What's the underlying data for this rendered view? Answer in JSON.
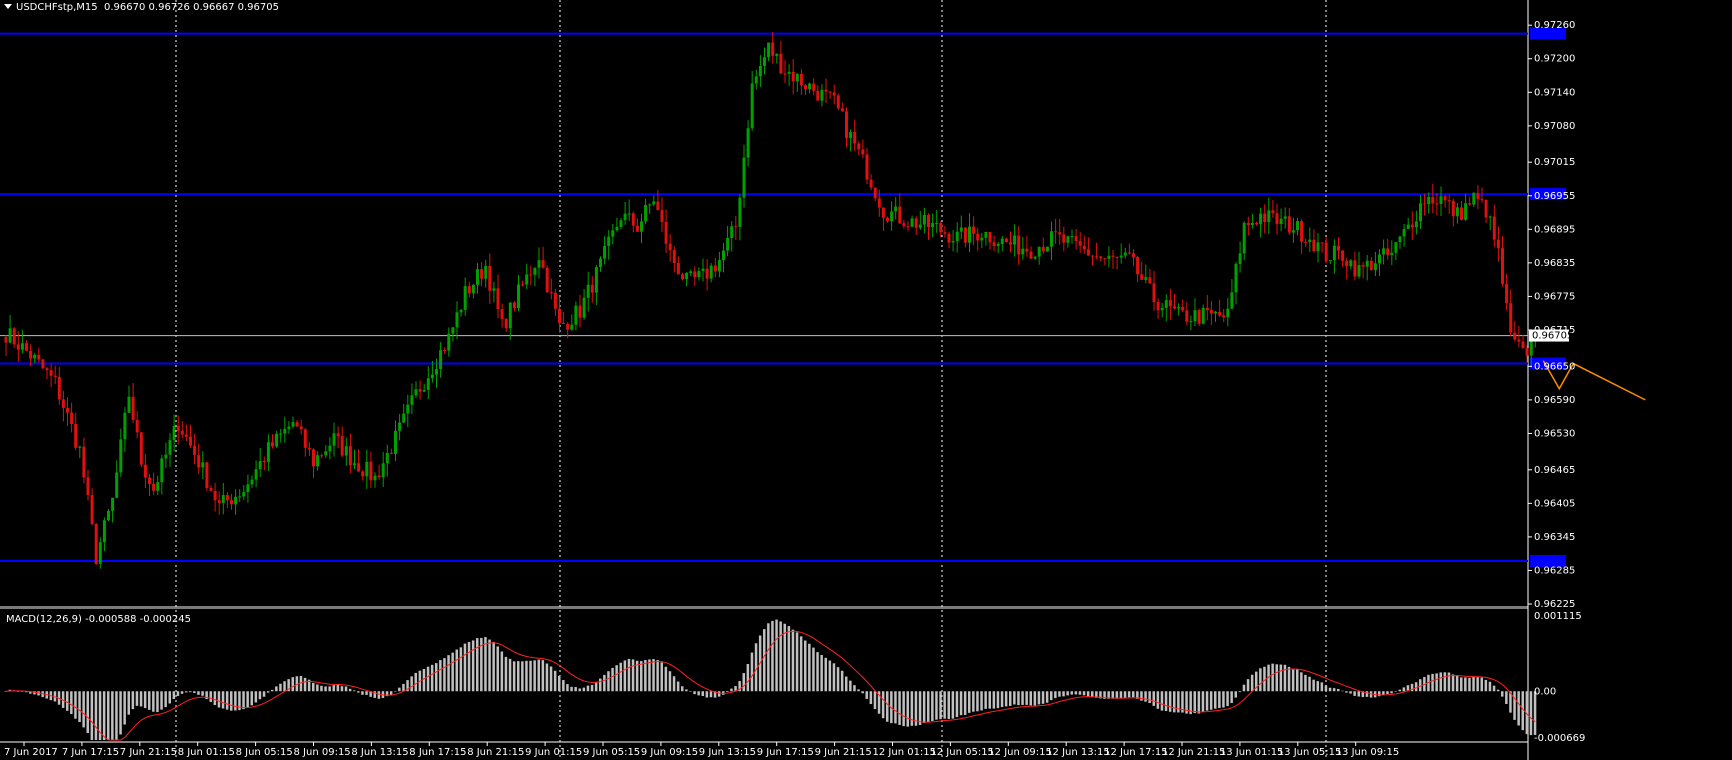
{
  "header": {
    "symbol": "USDCHFstp,M15",
    "open": "0.96670",
    "high": "0.96726",
    "low": "0.96667",
    "close": "0.96705"
  },
  "macd_header": {
    "label": "MACD(12,26,9)",
    "value1": "-0.000588",
    "value2": "-0.000245"
  },
  "colors": {
    "background": "#000000",
    "bull": "#00a000",
    "bear": "#e01010",
    "level_line": "#0000ff",
    "bid_line": "#c0c0c0",
    "forecast": "#ff8c00",
    "macd_hist": "#c0c0c0",
    "macd_signal": "#ff2020",
    "grid_sep": "#ffffff"
  },
  "price_axis": {
    "ticks": [
      "0.97260",
      "0.97200",
      "0.97140",
      "0.97080",
      "0.97015",
      "0.96955",
      "0.96895",
      "0.96835",
      "0.96775",
      "0.96715",
      "0.96650",
      "0.96590",
      "0.96530",
      "0.96465",
      "0.96405",
      "0.96345",
      "0.96285",
      "0.96225"
    ],
    "current_price_tag": "0.96705"
  },
  "macd_axis": {
    "ticks": [
      "0.001115",
      "0.00",
      "-0.000669"
    ]
  },
  "time_axis": {
    "labels": [
      "7 Jun 2017",
      "7 Jun 17:15",
      "7 Jun 21:15",
      "8 Jun 01:15",
      "8 Jun 05:15",
      "8 Jun 09:15",
      "8 Jun 13:15",
      "8 Jun 17:15",
      "8 Jun 21:15",
      "9 Jun 01:15",
      "9 Jun 05:15",
      "9 Jun 09:15",
      "9 Jun 13:15",
      "9 Jun 17:15",
      "9 Jun 21:15",
      "12 Jun 01:15",
      "12 Jun 05:15",
      "12 Jun 09:15",
      "12 Jun 13:15",
      "12 Jun 17:15",
      "12 Jun 21:15",
      "13 Jun 01:15",
      "13 Jun 05:15",
      "13 Jun 09:15"
    ]
  },
  "chart_data": {
    "type": "candlestick",
    "symbol": "USDCHFstp",
    "timeframe": "M15",
    "ylim": [
      0.96225,
      0.9728
    ],
    "horizontal_levels": [
      0.97245,
      0.96958,
      0.96655,
      0.96302
    ],
    "current_price": 0.96705,
    "price_path": [
      [
        0,
        0.9671
      ],
      [
        6,
        0.9667
      ],
      [
        12,
        0.9662
      ],
      [
        18,
        0.965
      ],
      [
        22,
        0.9631
      ],
      [
        26,
        0.9641
      ],
      [
        30,
        0.966
      ],
      [
        33,
        0.9648
      ],
      [
        36,
        0.9643
      ],
      [
        42,
        0.9655
      ],
      [
        47,
        0.9648
      ],
      [
        52,
        0.964
      ],
      [
        58,
        0.9643
      ],
      [
        64,
        0.965
      ],
      [
        70,
        0.9655
      ],
      [
        75,
        0.9648
      ],
      [
        80,
        0.9652
      ],
      [
        85,
        0.9648
      ],
      [
        90,
        0.9645
      ],
      [
        95,
        0.9652
      ],
      [
        100,
        0.966
      ],
      [
        104,
        0.9665
      ],
      [
        108,
        0.967
      ],
      [
        112,
        0.9678
      ],
      [
        117,
        0.9683
      ],
      [
        121,
        0.9672
      ],
      [
        125,
        0.9678
      ],
      [
        130,
        0.9685
      ],
      [
        135,
        0.9672
      ],
      [
        140,
        0.9675
      ],
      [
        145,
        0.9683
      ],
      [
        150,
        0.9692
      ],
      [
        154,
        0.969
      ],
      [
        158,
        0.9695
      ],
      [
        162,
        0.9685
      ],
      [
        166,
        0.968
      ],
      [
        170,
        0.9681
      ],
      [
        174,
        0.9684
      ],
      [
        178,
        0.969
      ],
      [
        182,
        0.9715
      ],
      [
        186,
        0.9722
      ],
      [
        190,
        0.9718
      ],
      [
        194,
        0.9716
      ],
      [
        198,
        0.9714
      ],
      [
        202,
        0.9712
      ],
      [
        206,
        0.9706
      ],
      [
        210,
        0.97
      ],
      [
        214,
        0.9693
      ],
      [
        220,
        0.9691
      ],
      [
        226,
        0.969
      ],
      [
        232,
        0.9688
      ],
      [
        238,
        0.9689
      ],
      [
        244,
        0.9687
      ],
      [
        250,
        0.9686
      ],
      [
        256,
        0.9688
      ],
      [
        262,
        0.9686
      ],
      [
        268,
        0.9684
      ],
      [
        274,
        0.9684
      ],
      [
        280,
        0.9677
      ],
      [
        286,
        0.9674
      ],
      [
        292,
        0.9674
      ],
      [
        298,
        0.9674
      ],
      [
        302,
        0.969
      ],
      [
        306,
        0.9692
      ],
      [
        310,
        0.9691
      ],
      [
        314,
        0.969
      ],
      [
        318,
        0.9688
      ],
      [
        322,
        0.9685
      ],
      [
        326,
        0.9685
      ],
      [
        330,
        0.9682
      ],
      [
        334,
        0.9684
      ],
      [
        338,
        0.9685
      ],
      [
        342,
        0.969
      ],
      [
        346,
        0.9695
      ],
      [
        350,
        0.9695
      ],
      [
        354,
        0.9692
      ],
      [
        358,
        0.9695
      ],
      [
        361,
        0.9693
      ],
      [
        364,
        0.9685
      ],
      [
        367,
        0.967
      ],
      [
        370,
        0.9667
      ],
      [
        373,
        0.967
      ]
    ],
    "forecast_path": [
      [
        0.9667,
        0.9661
      ],
      [
        0.9666,
        0.9659
      ]
    ],
    "macd": {
      "fast": 12,
      "slow": 26,
      "signal": 9,
      "main": -0.000588,
      "signal_value": -0.000245,
      "ylim": [
        -0.000669,
        0.001115
      ]
    }
  }
}
